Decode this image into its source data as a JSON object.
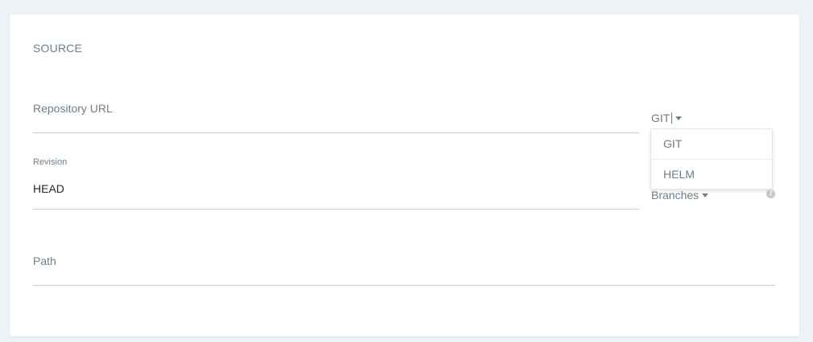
{
  "source": {
    "section_title": "SOURCE",
    "repository_url": {
      "placeholder": "Repository URL",
      "value": ""
    },
    "repo_type": {
      "selected": "GIT",
      "options": [
        "GIT",
        "HELM"
      ]
    },
    "revision": {
      "label": "Revision",
      "value": "HEAD"
    },
    "revision_type": {
      "selected": "Branches"
    },
    "path": {
      "placeholder": "Path",
      "value": ""
    },
    "help_icon_glyph": "?"
  },
  "colors": {
    "background": "#eef1f5",
    "card": "#ffffff",
    "label": "#6d7f8b",
    "text": "#1d2830",
    "underline": "#c8cfd4"
  }
}
